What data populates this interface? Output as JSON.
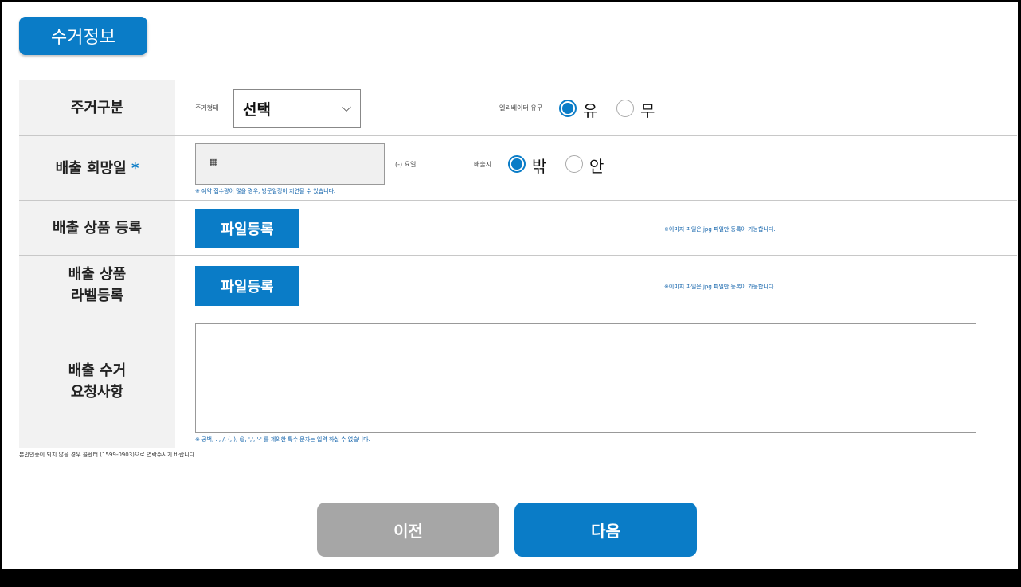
{
  "section_title": "수거정보",
  "colors": {
    "accent": "#0a7cc7",
    "prev_button": "#a6a6a6"
  },
  "rows": {
    "housing": {
      "label": "주거구분",
      "type_caption": "주거형태",
      "select_value": "선택",
      "elevator_caption": "엘리베이터 유무",
      "elevator_yes": "유",
      "elevator_no": "무",
      "elevator_selected": "유"
    },
    "date": {
      "label": "배출 희망일",
      "required_mark": "*",
      "weekday_caption": "(-) 요일",
      "place_caption": "배출지",
      "outside": "밖",
      "inside": "안",
      "place_selected": "밖",
      "note": "※ 예약 접수량이 많을 경우, 방문일정이 지연될 수 있습니다.",
      "calendar_icon": "calendar-icon"
    },
    "product_upload": {
      "label": "배출 상품 등록",
      "button": "파일등록",
      "note": "※이미지 파일은 jpg 파일만 등록이 가능합니다."
    },
    "label_upload": {
      "label_line1": "배출 상품",
      "label_line2": "라벨등록",
      "button": "파일등록",
      "note": "※이미지 파일은 jpg 파일만 등록이 가능합니다."
    },
    "request": {
      "label_line1": "배출 수거",
      "label_line2": "요청사항",
      "value": "",
      "note": "※ 공백, . , /, (, ), @, ',', '-' 를 제외한 특수 문자는 입력 하실 수 없습니다."
    }
  },
  "footnote": "본인인증이 되지 않을 경우 콜센터 (1599-0903)으로 연락주시기 바랍니다.",
  "buttons": {
    "prev": "이전",
    "next": "다음"
  }
}
